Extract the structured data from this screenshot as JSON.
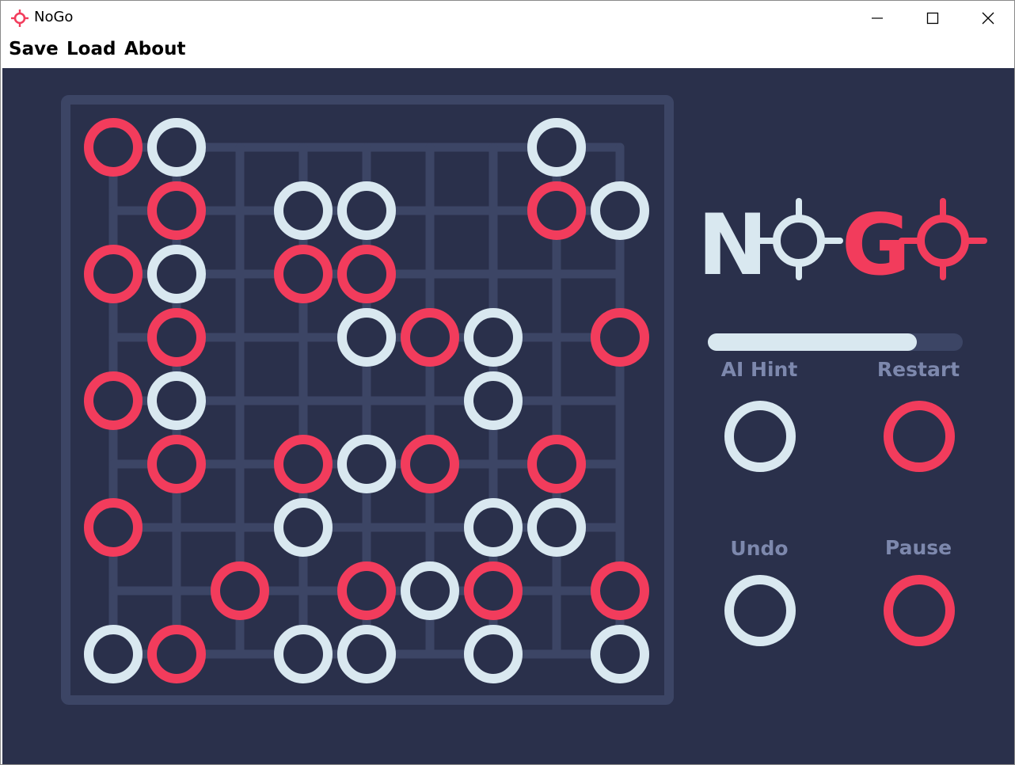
{
  "window": {
    "title": "NoGo",
    "app_icon": "crosshair-icon",
    "controls": [
      "minimize-icon",
      "maximize-icon",
      "close-icon"
    ]
  },
  "menu": {
    "save": "Save",
    "load": "Load",
    "about": "About"
  },
  "logo": {
    "part1": "N",
    "part2": "G"
  },
  "progress": {
    "fraction": 0.82
  },
  "controls": {
    "ai_hint": "AI Hint",
    "restart": "Restart",
    "undo": "Undo",
    "pause": "Pause"
  },
  "colors": {
    "background": "#2a304b",
    "grid": "#3c4565",
    "red": "#f23c5c",
    "white": "#d9e8f0",
    "label": "#7d88ad"
  },
  "board": {
    "size": 9,
    "rows": [
      "RW.....W.",
      ".R.WW..RW",
      "RW.RR....",
      ".R..WRW.R",
      "RW....W..",
      ".R.RWR.R.",
      "R..W..WW.",
      "..R.RWR.R",
      "WR.WW.W.W"
    ]
  }
}
